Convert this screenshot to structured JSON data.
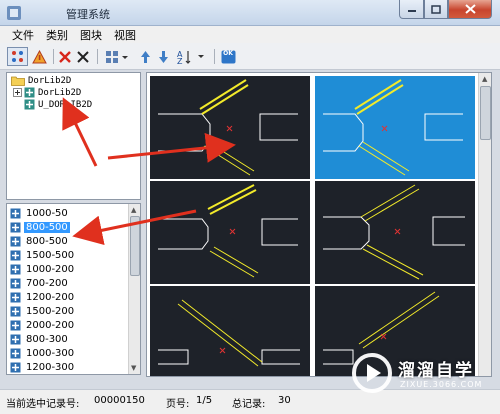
{
  "window": {
    "title": "管理系统"
  },
  "menu": [
    "文件",
    "类别",
    "图块",
    "视图"
  ],
  "toolbar": {
    "ok_label": "OK"
  },
  "tree": {
    "root": "DorLib2D",
    "children": [
      "DorLib2D",
      "U_DORLIB2D"
    ]
  },
  "list": {
    "items": [
      "1000-50",
      "800-500",
      "800-500",
      "1500-500",
      "1000-200",
      "700-200",
      "1200-200",
      "1500-200",
      "2000-200",
      "800-300",
      "1000-300",
      "1200-300"
    ],
    "selected_index": 1
  },
  "status": {
    "record_label": "当前选中记录号:",
    "record_value": "00000150",
    "page_label": "页号:",
    "page_value": "1/5",
    "total_label": "总记录:",
    "total_value": "30"
  },
  "watermark": {
    "name": "溜溜自学",
    "url": "ZIXUE.3066.COM"
  },
  "colors": {
    "cell_bg": "#1e2229",
    "cell_selected": "#1f8dd6",
    "accent_yellow": "#f2ea2a",
    "arrow_red": "#e0301e"
  }
}
